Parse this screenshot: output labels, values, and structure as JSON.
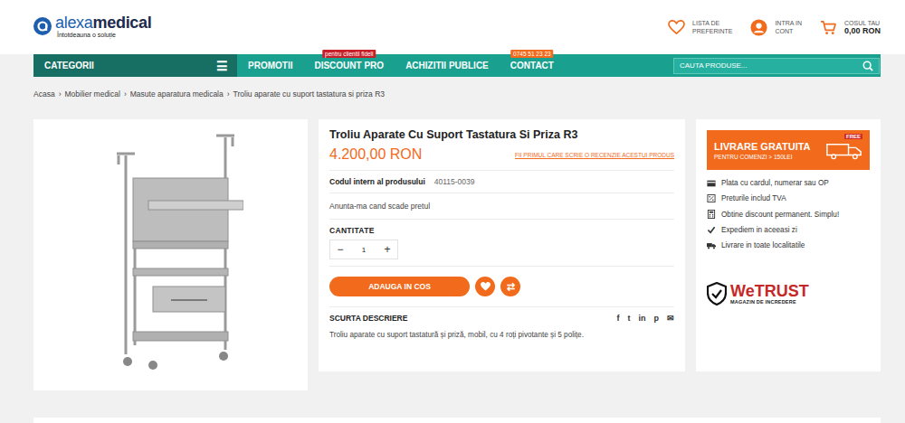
{
  "header": {
    "logo": {
      "brand_light": "alexa",
      "brand_bold": "medical",
      "tagline": "Întotdeauna o soluție"
    },
    "actions": [
      {
        "kind": "wishlist",
        "line1": "LISTA DE",
        "line2": "PREFERINTE"
      },
      {
        "kind": "account",
        "line1": "INTRA IN",
        "line2": "CONT"
      },
      {
        "kind": "cart",
        "line1": "COSUL TAU",
        "line2": "0,00 RON"
      }
    ]
  },
  "nav": {
    "categories": "CATEGORII",
    "menu_glyph": "☰",
    "items": [
      {
        "label": "PROMOTII",
        "badge": ""
      },
      {
        "label": "DISCOUNT PRO",
        "badge": "pentru clientii fideli",
        "badge_color": "#c8202a"
      },
      {
        "label": "ACHIZITII PUBLICE",
        "badge": ""
      },
      {
        "label": "CONTACT",
        "badge": "0745 51 23 23",
        "badge_color": "#f26a1b"
      }
    ],
    "search": {
      "placeholder": "CAUTA PRODUSE..."
    }
  },
  "breadcrumb": {
    "separator": "›",
    "items": [
      "Acasa",
      "Mobilier medical",
      "Masute aparatura medicala",
      "Troliu aparate cu suport tastatura si priza R3"
    ]
  },
  "product": {
    "title": "Troliu Aparate Cu Suport Tastatura Si Priza R3",
    "price": "4.200,00 RON",
    "review_link": "FII PRIMUL CARE SCRIE O RECENZIE ACESTUI PRODUS",
    "code_label": "Codul intern al produsului",
    "code": "40115-0039",
    "price_alert": "Anunta-ma cand scade pretul",
    "quantity_label": "CANTITATE",
    "quantity": {
      "minus": "−",
      "value": "1",
      "plus": "+"
    },
    "add_to_cart": "ADAUGA IN COS",
    "compare_glyph": "⇄",
    "short_description_label": "SCURTA DESCRIERE",
    "share_glyphs": [
      "f",
      "t",
      "in",
      "p",
      "✉"
    ],
    "short_description": "Troliu aparate cu suport tastatură și priză, mobil, cu 4 roți pivotante și 5 polițe."
  },
  "sidebar": {
    "banner": {
      "title": "LIVRARE GRATUITA",
      "subtitle": "PENTRU COMENZI > 150LEI",
      "tag": "FREE"
    },
    "benefits": [
      {
        "kind": "card",
        "text": "Plata cu cardul, numerar sau OP"
      },
      {
        "kind": "percent",
        "text": "Preturile includ TVA"
      },
      {
        "kind": "calculator",
        "text": "Obtine discount permanent. Simplu!"
      },
      {
        "kind": "check",
        "text": "Expediem in aceeasi zi"
      },
      {
        "kind": "truck",
        "text": "Livrare in toate localitatile"
      }
    ],
    "trust": {
      "brand_a": "We",
      "brand_b": "TRUST",
      "subtitle": "MAGAZIN DE INCREDERE"
    }
  }
}
